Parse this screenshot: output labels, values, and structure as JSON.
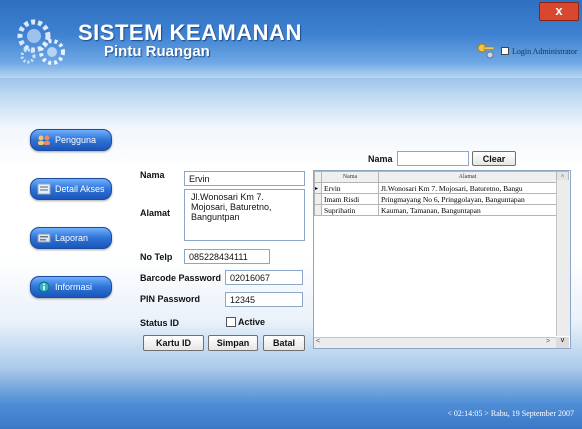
{
  "window": {
    "close_label": "x"
  },
  "header": {
    "title": "SISTEM KEAMANAN",
    "subtitle": "Pintu Ruangan",
    "login_label": "Login Administrator"
  },
  "sidebar": {
    "items": [
      {
        "label": "Pengguna",
        "icon": "users-icon"
      },
      {
        "label": "Detail Akses",
        "icon": "list-icon"
      },
      {
        "label": "Laporan",
        "icon": "report-icon"
      },
      {
        "label": "Informasi",
        "icon": "info-icon"
      }
    ]
  },
  "form": {
    "nama_label": "Nama",
    "nama_value": "Ervin",
    "alamat_label": "Alamat",
    "alamat_value": "Jl.Wonosari Km 7. Mojosari, Baturetno, Banguntpan",
    "telp_label": "No Telp",
    "telp_value": "085228434111",
    "barcode_label": "Barcode Password",
    "barcode_value": "02016067",
    "pin_label": "PIN Password",
    "pin_value": "12345",
    "status_label": "Status ID",
    "active_label": "Active",
    "active_checked": false
  },
  "buttons": {
    "kartu": "Kartu ID",
    "simpan": "Simpan",
    "batal": "Batal",
    "clear": "Clear"
  },
  "search": {
    "label": "Nama",
    "value": ""
  },
  "grid": {
    "columns": [
      "Nama",
      "Alamat"
    ],
    "rows": [
      {
        "nama": "Ervin",
        "alamat": "Jl.Wonosari Km 7. Mojosari, Baturetno, Bangu"
      },
      {
        "nama": "Imam Risdi",
        "alamat": "Pringmayang No 6, Pringgolayan, Banguntapan"
      },
      {
        "nama": "Suprihatin",
        "alamat": "Kauman, Tamanan, Banguntapan"
      }
    ]
  },
  "status": {
    "text": "< 02:14:05 > Rabu, 19 September 2007"
  },
  "colors": {
    "accent": "#2f73d6",
    "header": "#3f82d2"
  }
}
